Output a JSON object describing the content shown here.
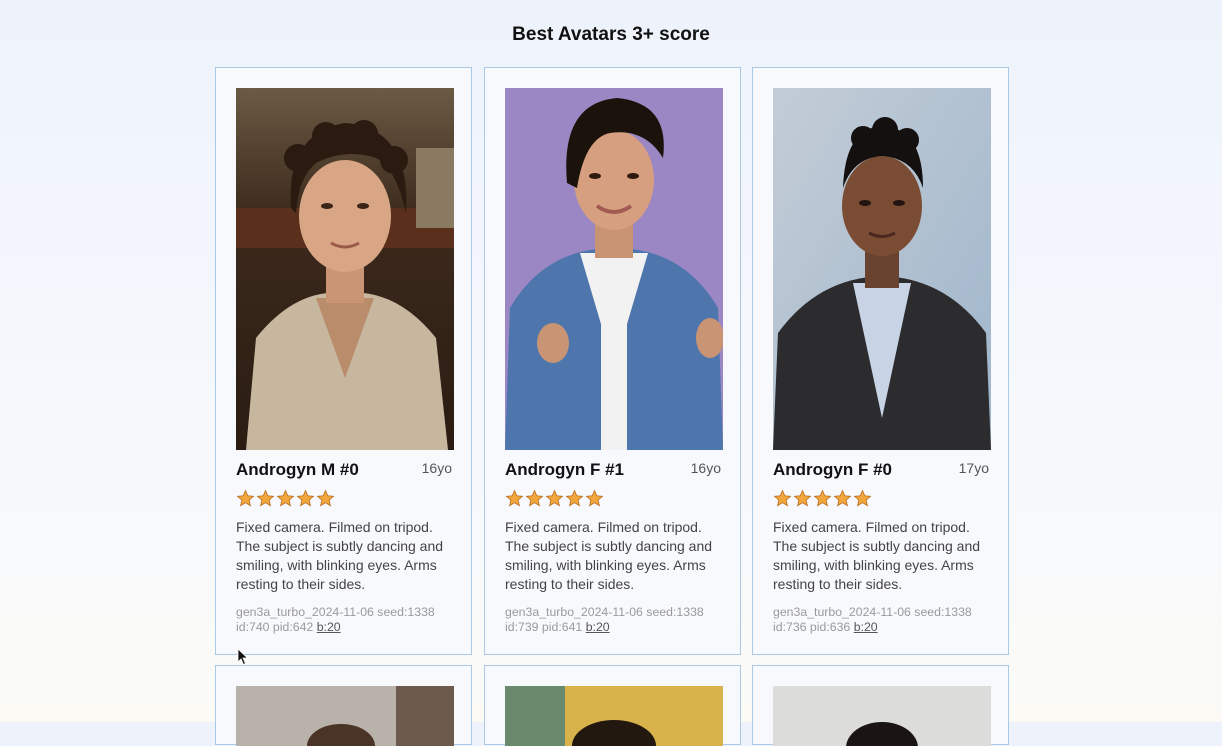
{
  "page": {
    "title": "Best Avatars 3+ score"
  },
  "cards": [
    {
      "name": "Androgyn M #0",
      "age": "16yo",
      "rating": 5,
      "description": "Fixed camera. Filmed on tripod. The subject is subtly dancing and smiling, with blinking eyes. Arms resting to their sides.",
      "meta_line1": "gen3a_turbo_2024-11-06 seed:1338",
      "meta_ids": "id:740 pid:642",
      "meta_link": "b:20"
    },
    {
      "name": "Androgyn F #1",
      "age": "16yo",
      "rating": 5,
      "description": "Fixed camera. Filmed on tripod. The subject is subtly dancing and smiling, with blinking eyes. Arms resting to their sides.",
      "meta_line1": "gen3a_turbo_2024-11-06 seed:1338",
      "meta_ids": "id:739 pid:641",
      "meta_link": "b:20"
    },
    {
      "name": "Androgyn F #0",
      "age": "17yo",
      "rating": 5,
      "description": "Fixed camera. Filmed on tripod. The subject is subtly dancing and smiling, with blinking eyes. Arms resting to their sides.",
      "meta_line1": "gen3a_turbo_2024-11-06 seed:1338",
      "meta_ids": "id:736 pid:636",
      "meta_link": "b:20"
    }
  ],
  "colors": {
    "card_border": "#a9c9e6",
    "star_fill": "#f0a63c",
    "star_stroke": "#b86a1e"
  },
  "icons": {
    "rating": "star-icon",
    "pointer": "mouse-cursor-icon"
  }
}
